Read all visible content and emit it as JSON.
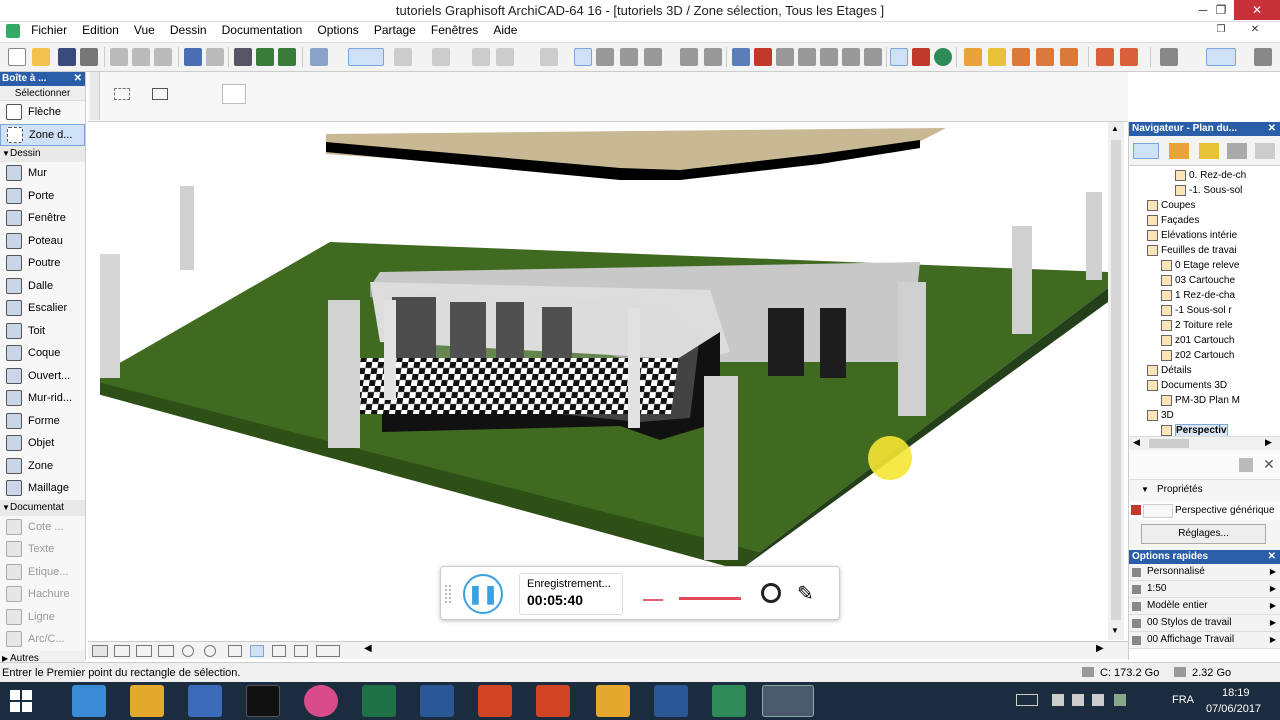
{
  "window": {
    "title": "tutoriels   Graphisoft ArchiCAD-64 16 - [tutoriels  3D / Zone sélection, Tous les Etages ]",
    "minimize": "─",
    "maximize": "❐",
    "close": "✕"
  },
  "menu": [
    "Fichier",
    "Edition",
    "Vue",
    "Dessin",
    "Documentation",
    "Options",
    "Partage",
    "Fenêtres",
    "Aide"
  ],
  "toolbox": {
    "title": "Boîte à ...",
    "select_header": "Sélectionner",
    "select_tools": [
      {
        "label": "Flèche",
        "icon": "arrow-cursor-icon"
      },
      {
        "label": "Zone d...",
        "icon": "marquee-icon"
      }
    ],
    "sections": [
      {
        "label": "Dessin",
        "tools": [
          {
            "label": "Mur",
            "icon": "wall-icon"
          },
          {
            "label": "Porte",
            "icon": "door-icon"
          },
          {
            "label": "Fenêtre",
            "icon": "window-icon"
          },
          {
            "label": "Poteau",
            "icon": "column-icon"
          },
          {
            "label": "Poutre",
            "icon": "beam-icon"
          },
          {
            "label": "Dalle",
            "icon": "slab-icon"
          },
          {
            "label": "Escalier",
            "icon": "stair-icon"
          },
          {
            "label": "Toit",
            "icon": "roof-icon"
          },
          {
            "label": "Coque",
            "icon": "shell-icon"
          },
          {
            "label": "Ouvert...",
            "icon": "opening-icon"
          },
          {
            "label": "Mur-rid...",
            "icon": "curtain-wall-icon"
          },
          {
            "label": "Forme",
            "icon": "morph-icon"
          },
          {
            "label": "Objet",
            "icon": "object-icon"
          },
          {
            "label": "Zone",
            "icon": "zone-icon"
          },
          {
            "label": "Maillage",
            "icon": "mesh-icon"
          }
        ]
      },
      {
        "label": "Documentat",
        "tools": [
          {
            "label": "Cote ...",
            "icon": "dimension-icon"
          },
          {
            "label": "Texte",
            "icon": "text-icon"
          },
          {
            "label": "Etique...",
            "icon": "label-icon"
          },
          {
            "label": "Hachure",
            "icon": "fill-icon"
          },
          {
            "label": "Ligne",
            "icon": "line-icon"
          },
          {
            "label": "Arc/C...",
            "icon": "arc-icon"
          }
        ]
      }
    ],
    "others": "Autres"
  },
  "navigator": {
    "title": "Navigateur - Plan du...",
    "items": [
      {
        "label": "0. Rez-de-ch",
        "indent": 4
      },
      {
        "label": "-1. Sous-sol",
        "indent": 4
      },
      {
        "label": "Coupes",
        "indent": 2
      },
      {
        "label": "Façades",
        "indent": 2
      },
      {
        "label": "Elévations intérie",
        "indent": 2
      },
      {
        "label": "Feuilles de travai",
        "indent": 2
      },
      {
        "label": "0 Etage releve",
        "indent": 3
      },
      {
        "label": "03 Cartouche",
        "indent": 3
      },
      {
        "label": "1 Rez-de-cha",
        "indent": 3
      },
      {
        "label": "-1 Sous-sol r",
        "indent": 3
      },
      {
        "label": "2 Toiture rele",
        "indent": 3
      },
      {
        "label": "z01 Cartouch",
        "indent": 3
      },
      {
        "label": "z02 Cartouch",
        "indent": 3
      },
      {
        "label": "Détails",
        "indent": 2
      },
      {
        "label": "Documents 3D",
        "indent": 2
      },
      {
        "label": "PM-3D Plan M",
        "indent": 3
      },
      {
        "label": "3D",
        "indent": 2
      },
      {
        "label": "Perspectiv",
        "indent": 3,
        "selected": true
      }
    ],
    "properties_label": "Propriétés",
    "properties_value": "Perspective générique",
    "settings_button": "Réglages..."
  },
  "quick_options": {
    "title": "Options rapides",
    "rows": [
      "Personnalisé",
      "1:50",
      "Modèle entier",
      "00 Stylos de travail",
      "00 Affichage Travail"
    ]
  },
  "recorder": {
    "status": "Enregistrement...",
    "time": "00:05:40"
  },
  "status": {
    "message": "Entrer le Premier point du rectangle de sélection.",
    "disk": "C: 173.2 Go",
    "memory": "2.32 Go"
  },
  "taskbar": {
    "language": "FRA",
    "time": "18:19",
    "date": "07/06/2017"
  }
}
